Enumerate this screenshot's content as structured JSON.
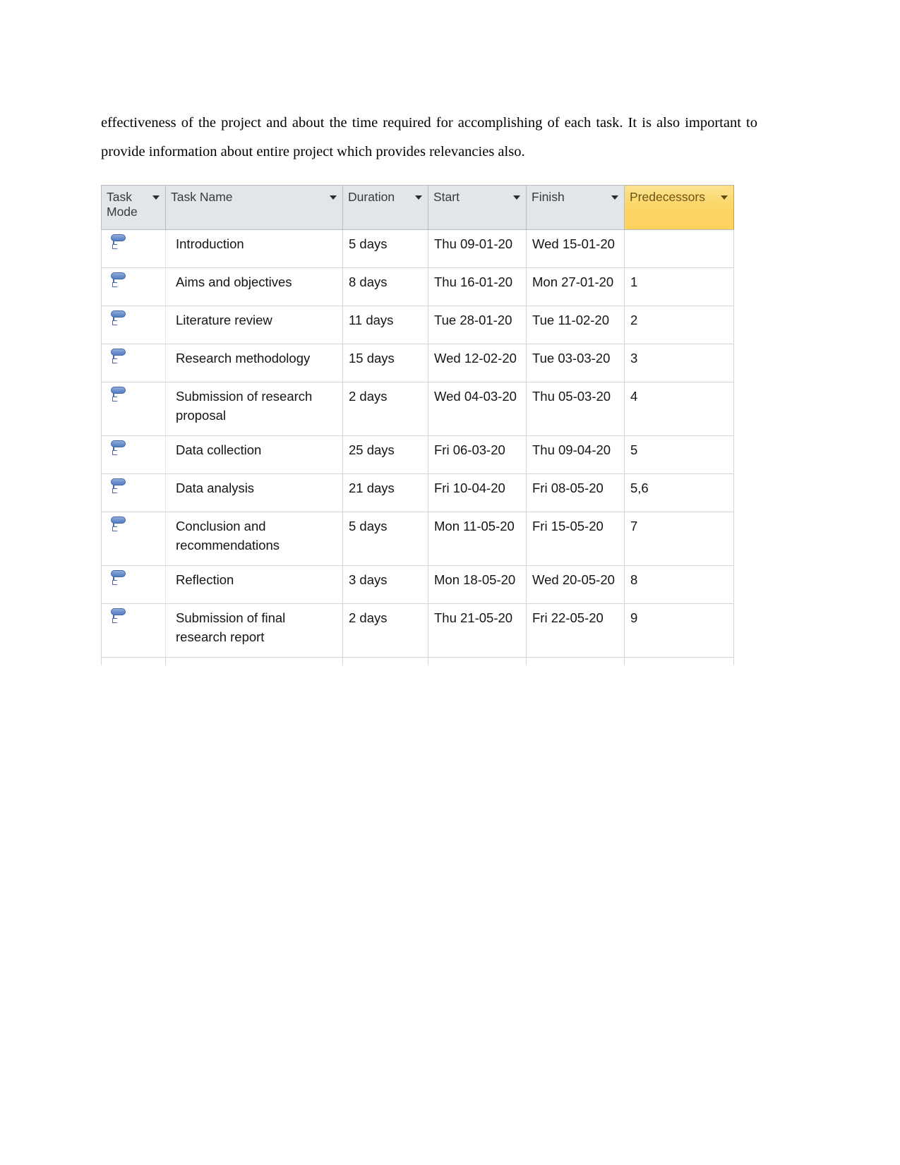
{
  "document": {
    "paragraph": "effectiveness of the project and about the time required for accomplishing of each task. It is also important to provide information about entire project which provides relevancies also."
  },
  "task_table": {
    "columns": [
      {
        "key": "task_mode",
        "label": "Task Mode",
        "has_filter": true,
        "highlighted": false
      },
      {
        "key": "task_name",
        "label": "Task Name",
        "has_filter": true,
        "highlighted": false
      },
      {
        "key": "duration",
        "label": "Duration",
        "has_filter": true,
        "highlighted": false
      },
      {
        "key": "start",
        "label": "Start",
        "has_filter": true,
        "highlighted": false
      },
      {
        "key": "finish",
        "label": "Finish",
        "has_filter": true,
        "highlighted": false
      },
      {
        "key": "predecessors",
        "label": "Predecessors",
        "has_filter": true,
        "highlighted": true
      }
    ],
    "header_highlight_color": "#fcd667",
    "header_background_color": "#e2e5e9",
    "task_mode_icon": "auto-scheduled-icon",
    "rows": [
      {
        "mode_icon": "auto-scheduled-icon",
        "name": "Introduction",
        "duration": "5 days",
        "start": "Thu 09-01-20",
        "finish": "Wed 15-01-20",
        "predecessors": ""
      },
      {
        "mode_icon": "auto-scheduled-icon",
        "name": "Aims and objectives",
        "duration": "8 days",
        "start": "Thu 16-01-20",
        "finish": "Mon 27-01-20",
        "predecessors": "1"
      },
      {
        "mode_icon": "auto-scheduled-icon",
        "name": "Literature review",
        "duration": "11 days",
        "start": "Tue 28-01-20",
        "finish": "Tue 11-02-20",
        "predecessors": "2"
      },
      {
        "mode_icon": "auto-scheduled-icon",
        "name": "Research methodology",
        "duration": "15 days",
        "start": "Wed 12-02-20",
        "finish": "Tue 03-03-20",
        "predecessors": "3"
      },
      {
        "mode_icon": "auto-scheduled-icon",
        "name": "Submission of research proposal",
        "duration": "2 days",
        "start": "Wed 04-03-20",
        "finish": "Thu 05-03-20",
        "predecessors": "4"
      },
      {
        "mode_icon": "auto-scheduled-icon",
        "name": "Data collection",
        "duration": "25 days",
        "start": "Fri 06-03-20",
        "finish": "Thu 09-04-20",
        "predecessors": "5"
      },
      {
        "mode_icon": "auto-scheduled-icon",
        "name": "Data analysis",
        "duration": "21 days",
        "start": "Fri 10-04-20",
        "finish": "Fri 08-05-20",
        "predecessors": "5,6"
      },
      {
        "mode_icon": "auto-scheduled-icon",
        "name": "Conclusion and recommendations",
        "duration": "5 days",
        "start": "Mon 11-05-20",
        "finish": "Fri 15-05-20",
        "predecessors": "7"
      },
      {
        "mode_icon": "auto-scheduled-icon",
        "name": "Reflection",
        "duration": "3 days",
        "start": "Mon 18-05-20",
        "finish": "Wed 20-05-20",
        "predecessors": "8"
      },
      {
        "mode_icon": "auto-scheduled-icon",
        "name": "Submission of final research report",
        "duration": "2 days",
        "start": "Thu 21-05-20",
        "finish": "Fri 22-05-20",
        "predecessors": "9"
      }
    ]
  }
}
